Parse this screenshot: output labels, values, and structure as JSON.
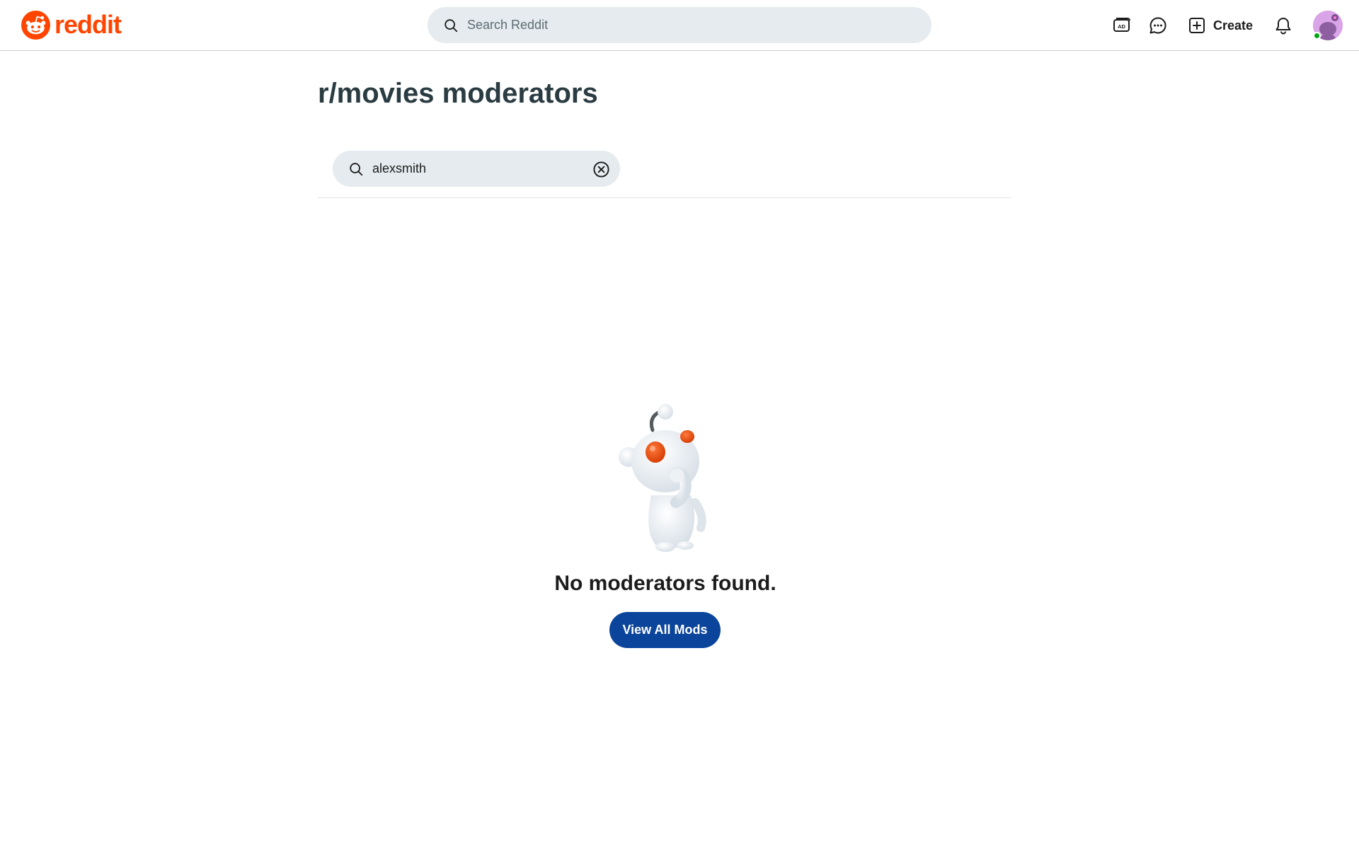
{
  "header": {
    "logo_text": "reddit",
    "search_placeholder": "Search Reddit",
    "icons": [
      "advertise-icon",
      "chat-icon",
      "plus-box-icon",
      "bell-icon",
      "user-avatar"
    ],
    "create_label": "Create"
  },
  "main": {
    "title": "r/movies moderators",
    "mod_search_value": "alexsmith",
    "empty_message": "No moderators found.",
    "view_all_label": "View All Mods"
  },
  "colors": {
    "brand": "#ff4500",
    "primary_button": "#0a449b",
    "search_bg": "#e5ebee",
    "title": "#2a3c42",
    "online": "#01a816"
  }
}
